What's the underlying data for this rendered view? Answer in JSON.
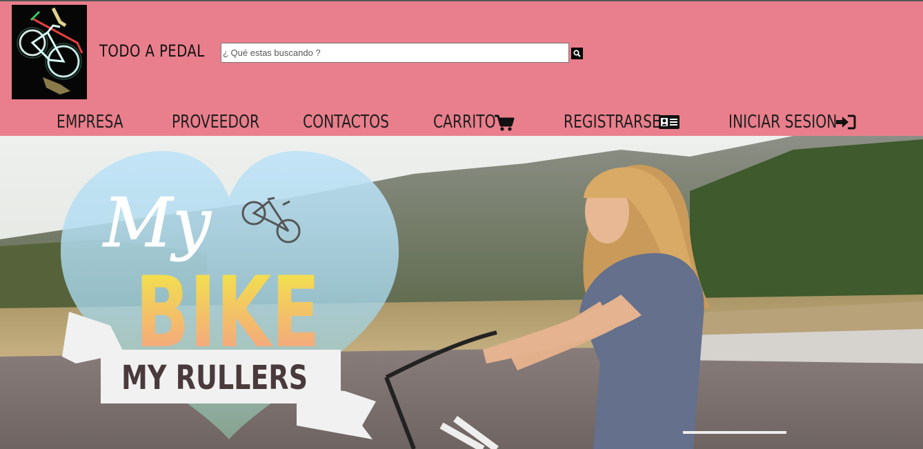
{
  "header": {
    "brand": "TODO A PEDAL",
    "search_placeholder": "¿ Qué estas buscando ?"
  },
  "nav": {
    "items": [
      {
        "label": "EMPRESA"
      },
      {
        "label": "PROVEEDOR"
      },
      {
        "label": "CONTACTOS"
      },
      {
        "label": "CARRITO",
        "icon": "cart-icon"
      },
      {
        "label": "REGISTRARSE",
        "icon": "id-card-icon"
      },
      {
        "label": "INICIAR SESION",
        "icon": "sign-in-icon"
      }
    ]
  },
  "hero": {
    "script_word": "My",
    "big_word": "BIKE",
    "banner_text": "MY RULLERS"
  },
  "colors": {
    "header_bg": "#e97f8c",
    "banner_text": "#4a3a3c",
    "bike_word_top": "#f2e34a",
    "bike_word_bottom": "#f49a8a"
  }
}
